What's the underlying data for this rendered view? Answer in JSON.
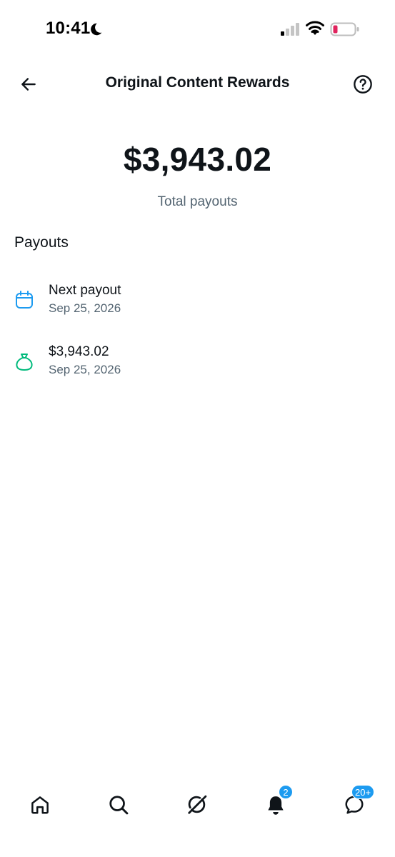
{
  "status_bar": {
    "time": "10:41",
    "icons": [
      "moon-icon",
      "signal-icon",
      "wifi-icon",
      "battery-icon"
    ]
  },
  "header": {
    "title": "Original Content Rewards",
    "back_icon": "arrow-left-icon",
    "help_icon": "question-circle-icon"
  },
  "summary": {
    "total_amount": "$3,943.02",
    "total_label": "Total payouts"
  },
  "payouts": {
    "section_title": "Payouts",
    "items": [
      {
        "icon": "calendar-icon",
        "title": "Next payout",
        "date": "Sep 25, 2026",
        "icon_color": "#1d9bf0"
      },
      {
        "icon": "money-bag-icon",
        "title": "$3,943.02",
        "date": "Sep 25, 2026",
        "icon_color": "#00ba7c"
      }
    ]
  },
  "bottom_nav": {
    "items": [
      {
        "name": "home",
        "icon": "home-icon"
      },
      {
        "name": "search",
        "icon": "search-icon"
      },
      {
        "name": "grok",
        "icon": "grok-icon"
      },
      {
        "name": "notifications",
        "icon": "bell-icon",
        "badge": "2"
      },
      {
        "name": "messages",
        "icon": "message-icon",
        "badge": "20+"
      }
    ]
  },
  "colors": {
    "accent": "#1d9bf0",
    "success": "#00ba7c",
    "text_primary": "#0f1419",
    "text_secondary": "#536471",
    "battery_low": "#e0245e"
  }
}
